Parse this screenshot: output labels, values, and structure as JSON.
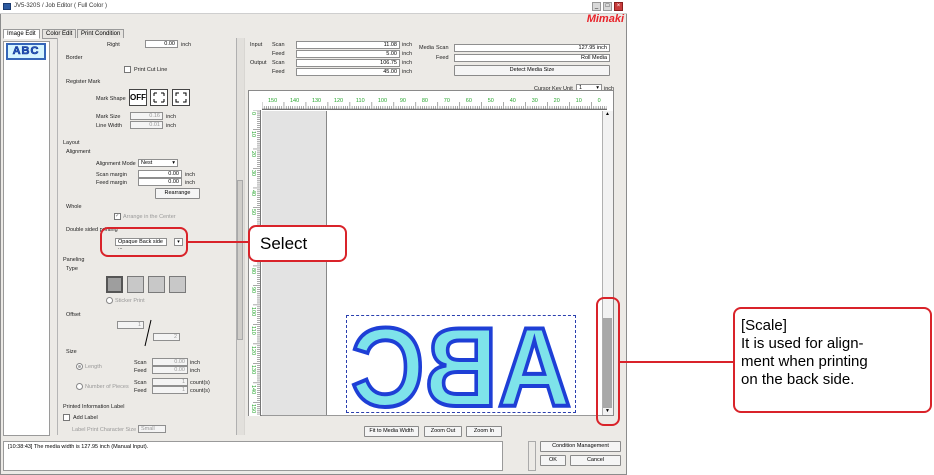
{
  "window": {
    "title": "JV5-320S / Job Editor ( Full Color )",
    "brand": "Mimaki",
    "minimize": "_",
    "maximize": "□",
    "close": "×"
  },
  "tabs": [
    "Image Edit",
    "Color Edit",
    "Print Condition"
  ],
  "thumbnail_text": "ABC",
  "left": {
    "right_label": "Right",
    "right_value": "0.00",
    "unit": "inch",
    "border_label": "Border",
    "print_cut_line": "Print Cut Line",
    "register_mark": "Register Mark",
    "mark_shape": "Mark Shape",
    "mark_shape_off": "OFF",
    "mark_size_label": "Mark Size",
    "mark_size_value": "0.16",
    "line_width_label": "Line Width",
    "line_width_value": "0.01",
    "layout": "Layout",
    "alignment": "Alignment",
    "alignment_mode_label": "Alignment Mode",
    "alignment_mode_value": "Nest",
    "scan_margin_label": "Scan margin",
    "scan_margin_value": "0.00",
    "feed_margin_label": "Feed margin",
    "feed_margin_value": "0.00",
    "rearrange": "Rearrange",
    "whole": "Whole",
    "arrange_center": "Arrange in the Center",
    "double_sided_label": "Double sided printing",
    "double_sided_value": "Opaque Back side ...",
    "paneling": "Paneling",
    "type": "Type",
    "sticker_print": "Sticker Print",
    "offset": "Offset",
    "offset_value1": "1",
    "offset_value2": "2",
    "size": "Size",
    "length": "Length",
    "scan": "Scan",
    "feed": "Feed",
    "size_scan_value": "0.00",
    "size_feed_value": "0.00",
    "number_of_pieces": "Number of Pieces",
    "pieces_scan_value": "1",
    "pieces_feed_value": "1",
    "counts_unit": "count(s)",
    "printed_info": "Printed Information Label",
    "add_label": "Add Label",
    "label_char_size": "Label Print Character Size",
    "label_char_size_value": "Small"
  },
  "info": {
    "input_label": "Input",
    "output_label": "Output",
    "scan": "Scan",
    "feed": "Feed",
    "input_scan": "11.08",
    "input_feed": "5.00",
    "output_scan": "106.75",
    "output_feed": "45.00",
    "unit": "inch",
    "media_label": "Media",
    "media_scan": "127.95 inch",
    "media_feed": "Roll Media",
    "detect_button": "Detect Media Size",
    "cursor_key_unit_label": "Cursor Key Unit",
    "cursor_key_unit_value": "1",
    "cursor_key_unit_suffix": "inch"
  },
  "ruler": {
    "h_ticks": [
      "150",
      "140",
      "130",
      "120",
      "110",
      "100",
      "90",
      "80",
      "70",
      "60",
      "50",
      "40",
      "30",
      "20",
      "10",
      "0"
    ],
    "v_ticks": [
      "0",
      "10",
      "20",
      "30",
      "40",
      "50",
      "60",
      "70",
      "80",
      "90",
      "100",
      "110",
      "120",
      "130",
      "140",
      "150"
    ]
  },
  "canvas_text": "ABC",
  "bottom_buttons": [
    "Fit to Media Width",
    "Zoom Out",
    "Zoom In"
  ],
  "status_message": "[10:38:43] The media width is 127.95 inch (Manual Input).",
  "dialog_buttons": {
    "condition": "Condition Management",
    "ok": "OK",
    "cancel": "Cancel"
  },
  "callouts": {
    "select": "Select",
    "scale_title": "[Scale]",
    "scale_line1": "It is used for align-",
    "scale_line2": "ment when printing",
    "scale_line3": "on the back side."
  },
  "colors": {
    "callout_red": "#d9232a",
    "glyph_fill": "#7ee3ea",
    "glyph_stroke": "#1e3fd6",
    "ruler_green": "#27a52e",
    "brand_red": "#e8232a"
  }
}
